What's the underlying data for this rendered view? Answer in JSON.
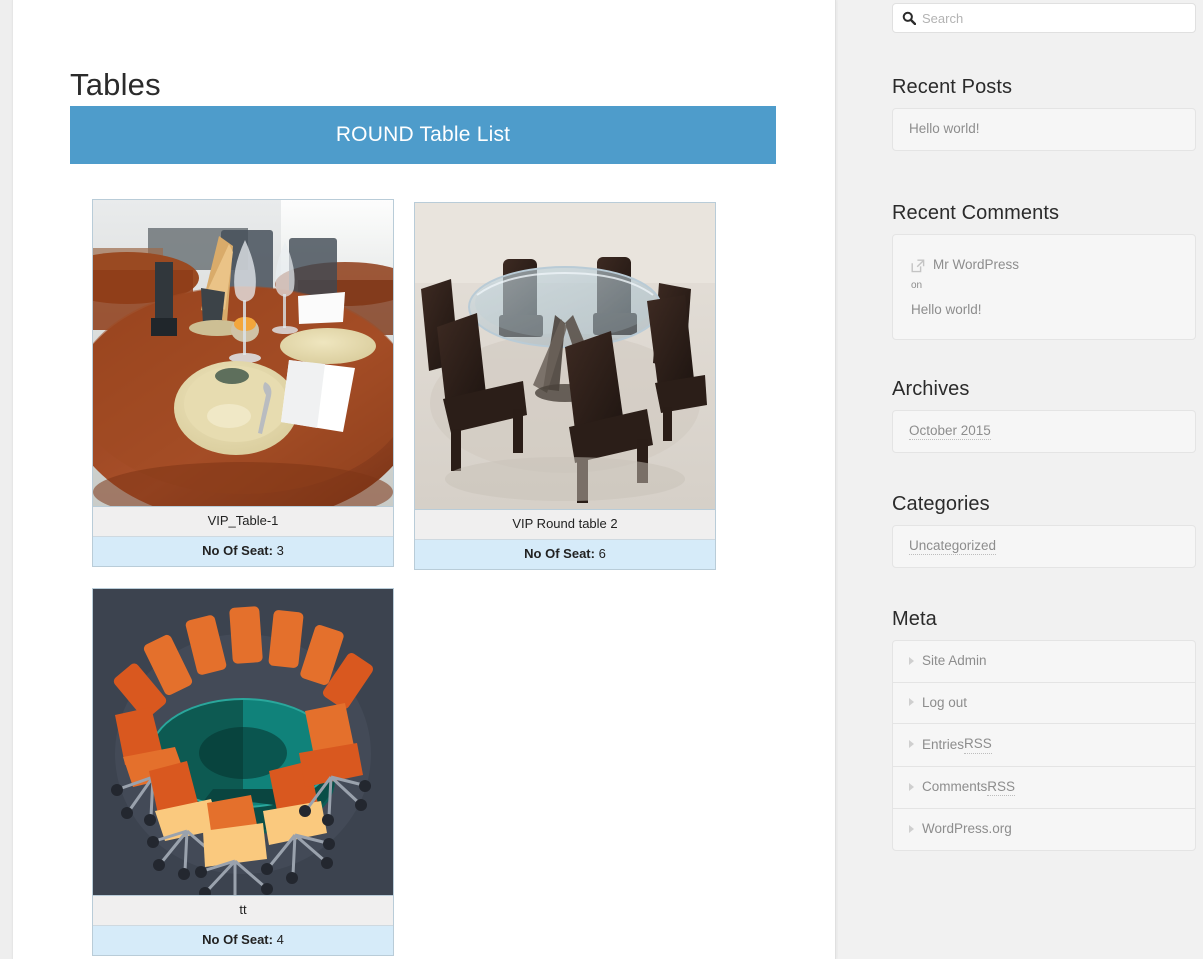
{
  "colors": {
    "header_bar": "#4e9ccb",
    "caption_name_bg": "#f0efef",
    "caption_seats_bg": "#d6ebf9",
    "card_border": "#b9ccd8",
    "sidebar_bg": "#f1f1f1",
    "muted_text": "#8d8d8d"
  },
  "main": {
    "page_title": "Tables",
    "list_header": "ROUND Table List",
    "seats_label": "No Of Seat:",
    "cards": [
      {
        "name": "VIP_Table-1",
        "seats": "3",
        "image": "restaurant-table-setting-photo"
      },
      {
        "name": "VIP Round table 2",
        "seats": "6",
        "image": "glass-round-table-with-chairs-render"
      },
      {
        "name": "tt",
        "seats": "4",
        "image": "isometric-conference-round-table-illustration"
      }
    ]
  },
  "sidebar": {
    "search": {
      "placeholder": "Search",
      "value": "",
      "icon": "search-icon"
    },
    "recent_posts": {
      "title": "Recent Posts",
      "items": [
        {
          "label": "Hello world!"
        }
      ]
    },
    "recent_comments": {
      "title": "Recent Comments",
      "icon": "external-link-icon",
      "author": "Mr WordPress",
      "on": "on",
      "post": "Hello world!"
    },
    "archives": {
      "title": "Archives",
      "items": [
        {
          "label": "October 2015"
        }
      ]
    },
    "categories": {
      "title": "Categories",
      "items": [
        {
          "label": "Uncategorized"
        }
      ]
    },
    "meta": {
      "title": "Meta",
      "items": [
        {
          "label": "Site Admin",
          "abbr": ""
        },
        {
          "label": "Log out",
          "abbr": ""
        },
        {
          "label": "Entries ",
          "abbr": "RSS"
        },
        {
          "label": "Comments ",
          "abbr": "RSS"
        },
        {
          "label": "WordPress.org",
          "abbr": ""
        }
      ]
    }
  }
}
